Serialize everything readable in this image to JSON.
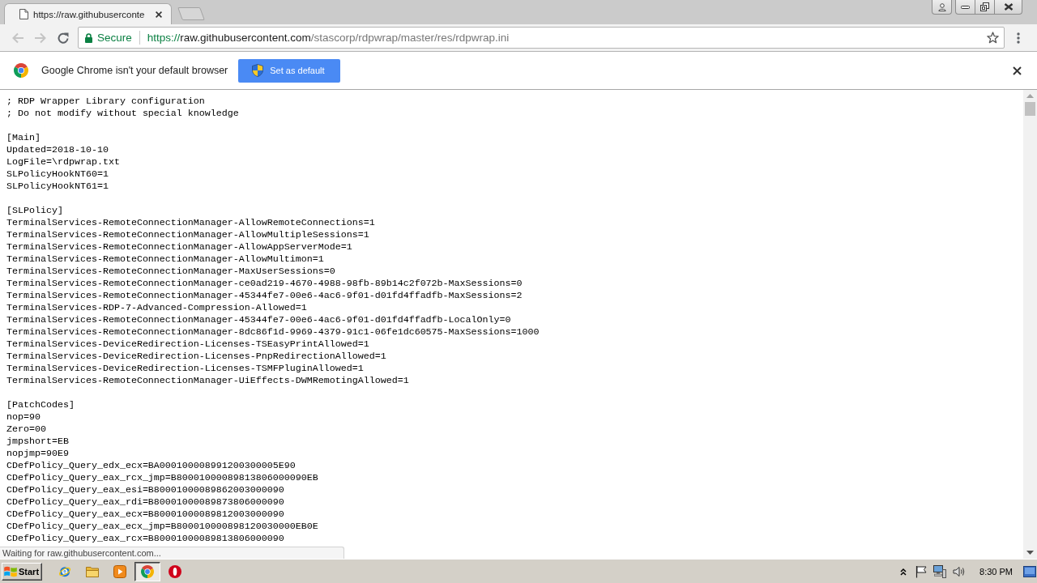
{
  "tabs": [
    {
      "title": "https://raw.githubuserconte",
      "selected": true
    }
  ],
  "toolbar": {
    "back": {
      "disabled": true
    },
    "forward": {
      "disabled": true
    },
    "omnibox": {
      "security": "Secure",
      "url": {
        "scheme": "https://",
        "host": "raw.githubusercontent.com",
        "path": "/stascorp/rdpwrap/master/res/rdpwrap.ini"
      },
      "bookmarked": false
    }
  },
  "infobar": {
    "message": "Google Chrome isn't your default browser",
    "button": "Set as default"
  },
  "document": {
    "sections": [
      {
        "lines": [
          "; RDP Wrapper Library configuration",
          "; Do not modify without special knowledge"
        ]
      },
      {
        "lines": [
          "[Main]",
          "Updated=2018-10-10",
          "LogFile=\\rdpwrap.txt",
          "SLPolicyHookNT60=1",
          "SLPolicyHookNT61=1"
        ]
      },
      {
        "lines": [
          "[SLPolicy]",
          "TerminalServices-RemoteConnectionManager-AllowRemoteConnections=1",
          "TerminalServices-RemoteConnectionManager-AllowMultipleSessions=1",
          "TerminalServices-RemoteConnectionManager-AllowAppServerMode=1",
          "TerminalServices-RemoteConnectionManager-AllowMultimon=1",
          "TerminalServices-RemoteConnectionManager-MaxUserSessions=0",
          "TerminalServices-RemoteConnectionManager-ce0ad219-4670-4988-98fb-89b14c2f072b-MaxSessions=0",
          "TerminalServices-RemoteConnectionManager-45344fe7-00e6-4ac6-9f01-d01fd4ffadfb-MaxSessions=2",
          "TerminalServices-RDP-7-Advanced-Compression-Allowed=1",
          "TerminalServices-RemoteConnectionManager-45344fe7-00e6-4ac6-9f01-d01fd4ffadfb-LocalOnly=0",
          "TerminalServices-RemoteConnectionManager-8dc86f1d-9969-4379-91c1-06fe1dc60575-MaxSessions=1000",
          "TerminalServices-DeviceRedirection-Licenses-TSEasyPrintAllowed=1",
          "TerminalServices-DeviceRedirection-Licenses-PnpRedirectionAllowed=1",
          "TerminalServices-DeviceRedirection-Licenses-TSMFPluginAllowed=1",
          "TerminalServices-RemoteConnectionManager-UiEffects-DWMRemotingAllowed=1"
        ]
      },
      {
        "lines": [
          "[PatchCodes]",
          "nop=90",
          "Zero=00",
          "jmpshort=EB",
          "nopjmp=90E9",
          "CDefPolicy_Query_edx_ecx=BA000100008991200300005E90",
          "CDefPolicy_Query_eax_rcx_jmp=B80001000089813806000090EB",
          "CDefPolicy_Query_eax_esi=B80001000089862003000090",
          "CDefPolicy_Query_eax_rdi=B80001000089873806000090",
          "CDefPolicy_Query_eax_ecx=B80001000089812003000090",
          "CDefPolicy_Query_eax_ecx_jmp=B800010000898120030000EB0E",
          "CDefPolicy_Query_eax_rcx=B80001000089813806000090"
        ]
      }
    ]
  },
  "status_bubble": "Waiting for raw.githubusercontent.com...",
  "taskbar": {
    "start": "Start",
    "apps": [
      {
        "kind": "ie",
        "selected": false
      },
      {
        "kind": "explorer",
        "selected": false
      },
      {
        "kind": "media",
        "selected": false
      },
      {
        "kind": "chrome",
        "selected": true
      },
      {
        "kind": "opera",
        "selected": false
      }
    ],
    "clock": "8:30 PM"
  }
}
